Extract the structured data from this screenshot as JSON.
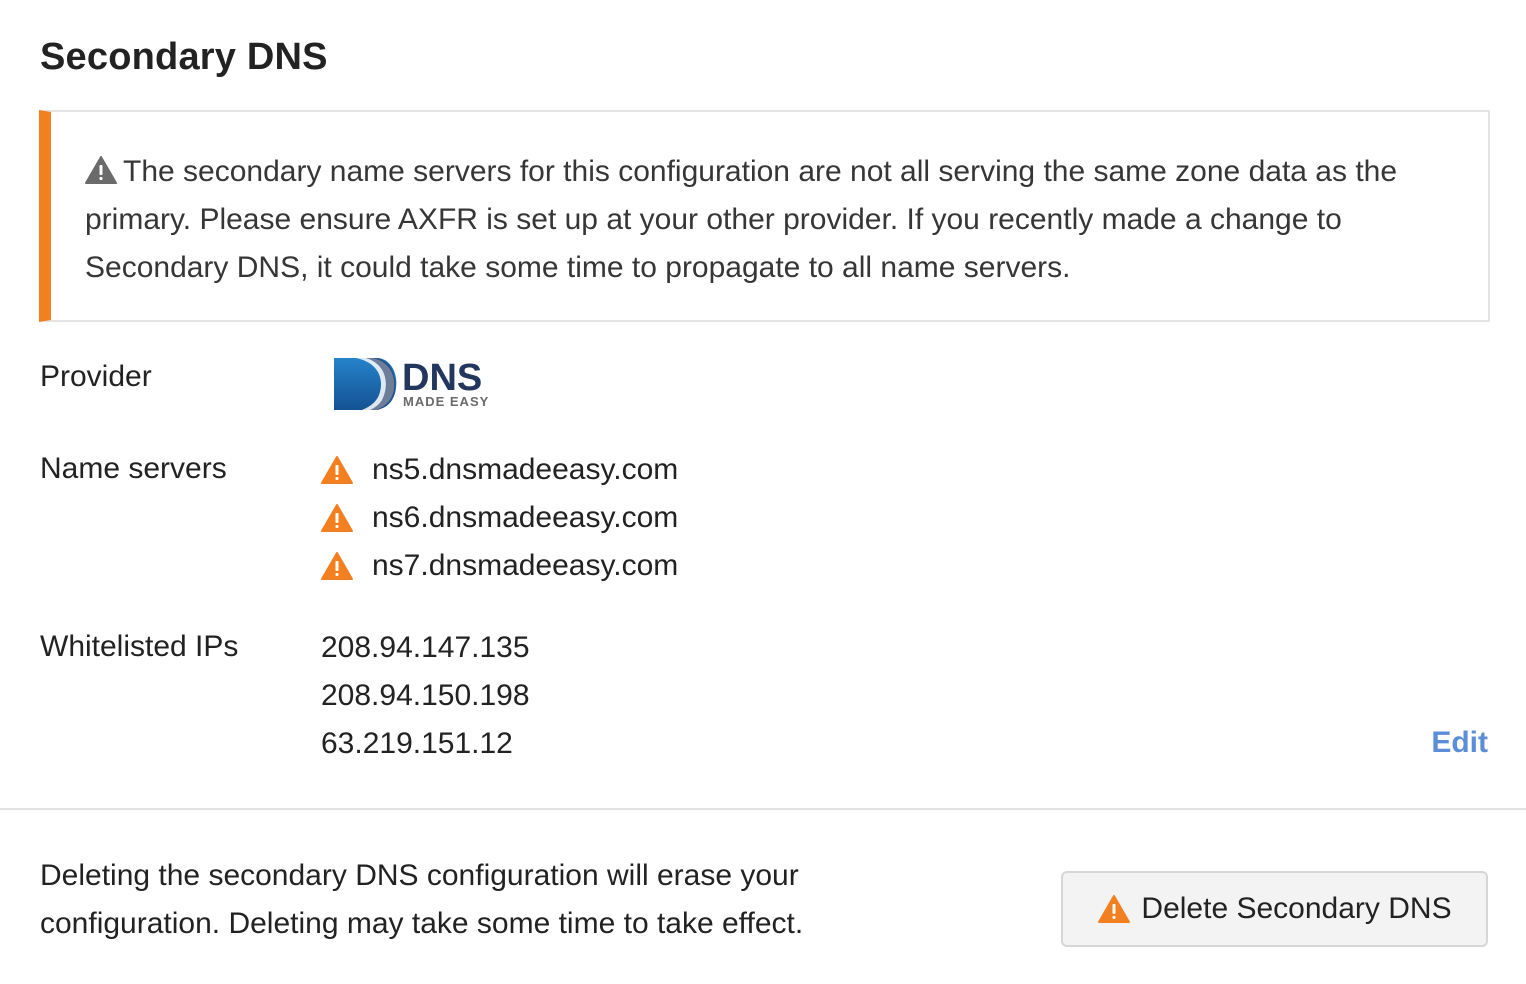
{
  "section": {
    "title": "Secondary DNS"
  },
  "alert": {
    "icon": "warning-icon",
    "message": "The secondary name servers for this configuration are not all serving the same zone data as the primary. Please ensure AXFR is set up at your other provider. If you recently made a change to Secondary DNS, it could take some time to propagate to all name servers.",
    "accent_color": "#f38020"
  },
  "provider": {
    "label": "Provider",
    "logo_text": "DNS",
    "logo_subtext": "MADE EASY"
  },
  "name_servers": {
    "label": "Name servers",
    "items": [
      {
        "icon": "warning-icon",
        "host": "ns5.dnsmadeeasy.com"
      },
      {
        "icon": "warning-icon",
        "host": "ns6.dnsmadeeasy.com"
      },
      {
        "icon": "warning-icon",
        "host": "ns7.dnsmadeeasy.com"
      }
    ]
  },
  "whitelisted_ips": {
    "label": "Whitelisted IPs",
    "items": [
      "208.94.147.135",
      "208.94.150.198",
      "63.219.151.12"
    ]
  },
  "edit_label": "Edit",
  "footer": {
    "description": "Deleting the secondary DNS configuration will erase your configuration. Deleting may take some time to take effect.",
    "delete_button_label": "Delete Secondary DNS",
    "delete_button_icon": "warning-icon"
  },
  "colors": {
    "warning": "#f38020",
    "link": "#5b8ed6",
    "logo_blue": "#1d6fb8",
    "logo_navy": "#23365e"
  }
}
